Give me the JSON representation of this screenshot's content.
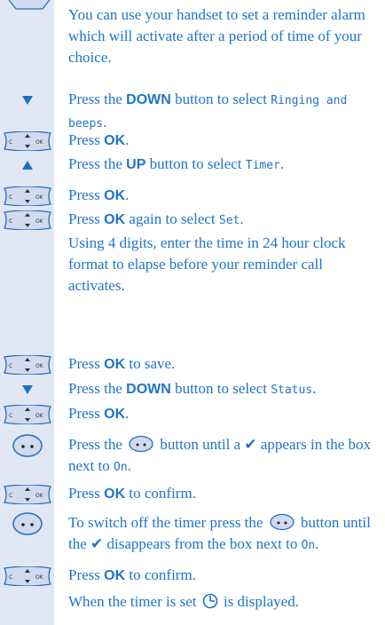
{
  "intro": "You can use your handset to set a reminder alarm which will activate after a period of time of your choice.",
  "steps": [
    {
      "icon": "down-arrow",
      "pre": "Press the ",
      "bold": "DOWN",
      "mid": " button to select ",
      "code": "Ringing and beeps",
      "post": "."
    },
    {
      "icon": "ok-navigator",
      "pre": "Press ",
      "bold": "OK",
      "post": "."
    },
    {
      "icon": "up-arrow",
      "pre": "Press the ",
      "bold": "UP",
      "mid": " button to select ",
      "code": "Timer",
      "post": "."
    },
    {
      "icon": "ok-navigator",
      "pre": "Press ",
      "bold": "OK",
      "post": "."
    },
    {
      "icon": "ok-navigator",
      "pre": "Press ",
      "bold": "OK",
      "mid": " again to select ",
      "code": "Set",
      "post": "."
    },
    {
      "text": "Using 4 digits, enter the time in 24 hour clock format to elapse before your reminder call activates."
    },
    {
      "icon": "ok-navigator",
      "pre": "Press ",
      "bold": "OK",
      "post": " to save."
    },
    {
      "icon": "down-arrow",
      "pre": "Press the ",
      "bold": "DOWN",
      "mid": " button to select ",
      "code": "Status",
      "post": "."
    },
    {
      "icon": "ok-navigator",
      "pre": "Press ",
      "bold": "OK",
      "post": "."
    },
    {
      "icon": "option-button",
      "pre": "Press the ",
      "mid": " button until a ",
      "check": "✔",
      "post": " appears in the box next to ",
      "code": "On",
      "end": "."
    },
    {
      "icon": "ok-navigator",
      "pre": "Press ",
      "bold": "OK",
      "post": " to confirm."
    },
    {
      "icon": "option-button",
      "pre": "To switch off the timer press the ",
      "mid": " button until the ",
      "check": "✔",
      "post": " disappears from the box next to ",
      "code": "On",
      "end": "."
    },
    {
      "icon": "ok-navigator",
      "pre": "Press ",
      "bold": "OK",
      "post": " to confirm."
    },
    {
      "pre": "When the timer is set ",
      "post": " is displayed.",
      "inline_icon": "timer-icon"
    }
  ],
  "colors": {
    "text": "#1f74c9",
    "sidebar": "#e2e7f4",
    "icon_fill": "#d2daf0",
    "icon_stroke": "#1f6fc0"
  }
}
